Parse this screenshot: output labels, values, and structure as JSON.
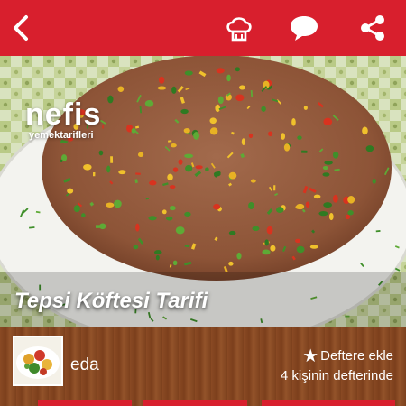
{
  "header": {
    "back_icon": "chevron-left-icon",
    "chef_icon": "chef-hat-icon",
    "comment_icon": "speech-bubble-icon",
    "share_icon": "share-icon",
    "accent_color": "#d81f2d"
  },
  "hero": {
    "logo_main": "nefis",
    "logo_sub": "yemektarifleri",
    "recipe_title": "Tepsi Köftesi Tarifi"
  },
  "info": {
    "author_name": "eda",
    "favorite_label": "Deftere ekle",
    "favorite_count_text": "4 kişinin defterinde"
  }
}
